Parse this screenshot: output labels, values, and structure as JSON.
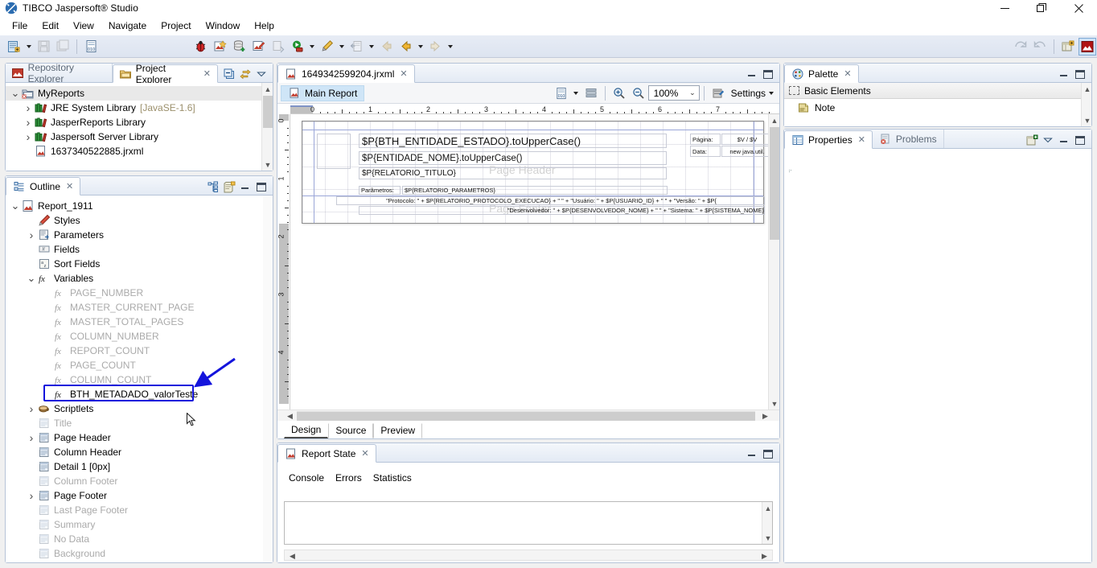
{
  "window": {
    "title": "TIBCO Jaspersoft® Studio",
    "app_icon": "jaspersoft-logo-icon",
    "minimize": "—",
    "maximize": "❐",
    "close": "✕"
  },
  "menubar": {
    "items": [
      "File",
      "Edit",
      "View",
      "Navigate",
      "Project",
      "Window",
      "Help"
    ]
  },
  "toolbar": {
    "groups": [
      {
        "icons": [
          "new-report-icon",
          "dropdown-arrow",
          "save-icon",
          "save-all-icon"
        ]
      },
      {
        "icons": [
          "compile-report-icon"
        ]
      },
      {
        "icons": [
          "debug-icon",
          "new-jrxml-icon",
          "new-datasource-icon",
          "new-adapter-icon",
          "export-icon",
          "run-icon",
          "dropdown-arrow",
          "format-brush-icon",
          "dropdown-arrow",
          "import-icon",
          "dropdown-arrow",
          "back-disabled-icon",
          "back-icon",
          "dropdown-arrow",
          "forward-icon",
          "dropdown-arrow"
        ]
      },
      {
        "icons": [
          "undo-icon",
          "redo-icon"
        ]
      }
    ],
    "perspectives": [
      "open-perspective-icon",
      "jaspersoft-perspective-icon"
    ]
  },
  "project_explorer": {
    "tabs": [
      {
        "label": "Repository Explorer",
        "icon": "repository-icon",
        "active": false,
        "closable": false
      },
      {
        "label": "Project Explorer",
        "icon": "project-folder-icon",
        "active": true,
        "closable": true
      }
    ],
    "actions": [
      "collapse-all-icon",
      "link-with-editor-icon",
      "view-menu-icon"
    ],
    "tree": [
      {
        "label": "MyReports",
        "icon": "project-icon",
        "indent": 0,
        "twist": "open",
        "muted": false,
        "selected": true,
        "sublabel": ""
      },
      {
        "label": "JRE System Library",
        "icon": "library-icon",
        "indent": 1,
        "twist": "closed",
        "muted": false,
        "selected": false,
        "sublabel": "[JavaSE-1.6]"
      },
      {
        "label": "JasperReports Library",
        "icon": "library-icon",
        "indent": 1,
        "twist": "closed",
        "muted": false,
        "selected": false,
        "sublabel": ""
      },
      {
        "label": "Jaspersoft Server Library",
        "icon": "library-icon",
        "indent": 1,
        "twist": "closed",
        "muted": false,
        "selected": false,
        "sublabel": ""
      },
      {
        "label": "1637340522885.jrxml",
        "icon": "jrxml-file-icon",
        "indent": 1,
        "twist": "none",
        "muted": false,
        "selected": false,
        "sublabel": ""
      }
    ]
  },
  "outline": {
    "tab": {
      "label": "Outline",
      "icon": "outline-icon",
      "closable": true
    },
    "actions": [
      "show-tree-icon",
      "properties-icon",
      "minimize-icon",
      "maximize-icon"
    ],
    "tree": [
      {
        "label": "Report_1911",
        "icon": "report-icon",
        "indent": 0,
        "twist": "open",
        "muted": false,
        "highlight": false
      },
      {
        "label": "Styles",
        "icon": "styles-icon",
        "indent": 1,
        "twist": "none",
        "muted": false,
        "highlight": false
      },
      {
        "label": "Parameters",
        "icon": "parameters-icon",
        "indent": 1,
        "twist": "closed",
        "muted": false,
        "highlight": false
      },
      {
        "label": "Fields",
        "icon": "fields-icon",
        "indent": 1,
        "twist": "none",
        "muted": false,
        "highlight": false
      },
      {
        "label": "Sort Fields",
        "icon": "sort-fields-icon",
        "indent": 1,
        "twist": "none",
        "muted": false,
        "highlight": false
      },
      {
        "label": "Variables",
        "icon": "variables-fx-icon",
        "indent": 1,
        "twist": "open",
        "muted": false,
        "highlight": false
      },
      {
        "label": "PAGE_NUMBER",
        "icon": "fx-icon",
        "indent": 2,
        "twist": "none",
        "muted": true,
        "highlight": false
      },
      {
        "label": "MASTER_CURRENT_PAGE",
        "icon": "fx-icon",
        "indent": 2,
        "twist": "none",
        "muted": true,
        "highlight": false
      },
      {
        "label": "MASTER_TOTAL_PAGES",
        "icon": "fx-icon",
        "indent": 2,
        "twist": "none",
        "muted": true,
        "highlight": false
      },
      {
        "label": "COLUMN_NUMBER",
        "icon": "fx-icon",
        "indent": 2,
        "twist": "none",
        "muted": true,
        "highlight": false
      },
      {
        "label": "REPORT_COUNT",
        "icon": "fx-icon",
        "indent": 2,
        "twist": "none",
        "muted": true,
        "highlight": false
      },
      {
        "label": "PAGE_COUNT",
        "icon": "fx-icon",
        "indent": 2,
        "twist": "none",
        "muted": true,
        "highlight": false
      },
      {
        "label": "COLUMN_COUNT",
        "icon": "fx-icon",
        "indent": 2,
        "twist": "none",
        "muted": true,
        "highlight": false
      },
      {
        "label": "BTH_METADADO_valorTeste",
        "icon": "fx-icon",
        "indent": 2,
        "twist": "none",
        "muted": false,
        "highlight": true
      },
      {
        "label": "Scriptlets",
        "icon": "scriptlets-icon",
        "indent": 1,
        "twist": "closed",
        "muted": false,
        "highlight": false
      },
      {
        "label": "Title",
        "icon": "band-icon",
        "indent": 1,
        "twist": "none",
        "muted": true,
        "highlight": false
      },
      {
        "label": "Page Header",
        "icon": "band-icon",
        "indent": 1,
        "twist": "closed",
        "muted": false,
        "highlight": false
      },
      {
        "label": "Column Header",
        "icon": "band-icon",
        "indent": 1,
        "twist": "none",
        "muted": false,
        "highlight": false
      },
      {
        "label": "Detail 1 [0px]",
        "icon": "band-icon",
        "indent": 1,
        "twist": "none",
        "muted": false,
        "highlight": false
      },
      {
        "label": "Column Footer",
        "icon": "band-icon",
        "indent": 1,
        "twist": "none",
        "muted": true,
        "highlight": false
      },
      {
        "label": "Page Footer",
        "icon": "band-icon",
        "indent": 1,
        "twist": "closed",
        "muted": false,
        "highlight": false
      },
      {
        "label": "Last Page Footer",
        "icon": "band-icon",
        "indent": 1,
        "twist": "none",
        "muted": true,
        "highlight": false
      },
      {
        "label": "Summary",
        "icon": "band-icon",
        "indent": 1,
        "twist": "none",
        "muted": true,
        "highlight": false
      },
      {
        "label": "No Data",
        "icon": "band-icon",
        "indent": 1,
        "twist": "none",
        "muted": true,
        "highlight": false
      },
      {
        "label": "Background",
        "icon": "band-icon",
        "indent": 1,
        "twist": "none",
        "muted": true,
        "highlight": false
      }
    ]
  },
  "editor": {
    "tab": {
      "label": "1649342599204.jrxml",
      "icon": "jrxml-file-icon",
      "closable": true
    },
    "actions": [
      "minimize-icon",
      "maximize-icon"
    ],
    "toolbar": {
      "main_report_label": "Main Report",
      "main_report_icon": "report-icon",
      "icons": [
        "compile-icon",
        "dropdown-arrow",
        "bands-icon"
      ],
      "zoom_in_icon": "zoom-in-icon",
      "zoom_out_icon": "zoom-out-icon",
      "zoom_value": "100%",
      "settings_icon": "settings-icon",
      "settings_label": "Settings",
      "settings_arrow": "dropdown-arrow"
    },
    "ruler_h": [
      "0",
      "1",
      "2",
      "3",
      "4",
      "5",
      "6",
      "7"
    ],
    "ruler_v": [
      "0",
      "1",
      "2",
      "3",
      "4"
    ],
    "bands": [
      {
        "name": "Page Header",
        "watermark": "Page Header"
      },
      {
        "name": "Page Footer",
        "watermark": "Page Footer"
      }
    ],
    "elements": [
      {
        "id": "entidade-estado",
        "text": "$P{BTH_ENTIDADE_ESTADO}.toUpperCase()",
        "size": "lg"
      },
      {
        "id": "entidade-nome",
        "text": "$P{ENTIDADE_NOME}.toUpperCase()",
        "size": "md"
      },
      {
        "id": "relatorio-titulo",
        "text": "$P{RELATORIO_TITULO}",
        "size": "sm"
      },
      {
        "id": "parametros-label",
        "text": "Parâmetros:",
        "size": "xs"
      },
      {
        "id": "parametros-value",
        "text": "$P{RELATORIO_PARAMETROS}",
        "size": "xs"
      },
      {
        "id": "protocolo-line",
        "text": "\"Protocolo: \" +  $P{RELATORIO_PROTOCOLO_EXECUCAO} + \"    \" + \"Usuário: \" + $P{USUARIO_ID} + \"     \" + \"Versão: \" + $P{",
        "size": "xs"
      },
      {
        "id": "desenvolvedor-line",
        "text": "\"Desenvolvedor: \" +  $P{DESENVOLVEDOR_NOME} + \"    \" + \"Sistema: \" + $P{SISTEMA_NOME}",
        "size": "xs"
      },
      {
        "id": "pagina-label",
        "text": "Página:",
        "size": "xs"
      },
      {
        "id": "pagina-value",
        "text": "$V /    $V",
        "size": "xs"
      },
      {
        "id": "data-label",
        "text": "Data:",
        "size": "xs"
      },
      {
        "id": "data-value",
        "text": "new java.util.",
        "size": "xs"
      }
    ],
    "bottom_tabs": [
      {
        "label": "Design",
        "active": true
      },
      {
        "label": "Source",
        "active": false
      },
      {
        "label": "Preview",
        "active": false
      }
    ]
  },
  "report_state": {
    "tab": {
      "label": "Report State",
      "icon": "report-icon",
      "closable": true
    },
    "actions": [
      "minimize-icon",
      "maximize-icon"
    ],
    "subtabs": [
      "Console",
      "Errors",
      "Statistics"
    ],
    "console_text": ""
  },
  "palette": {
    "tab": {
      "label": "Palette",
      "icon": "palette-icon",
      "closable": true
    },
    "actions": [
      "minimize-icon",
      "maximize-icon"
    ],
    "category": {
      "label": "Basic Elements",
      "icon": "dashed-box-icon",
      "collapse_icon": "collapse-icon"
    },
    "items": [
      {
        "label": "Note",
        "icon": "note-icon"
      }
    ]
  },
  "properties": {
    "tabs": [
      {
        "label": "Properties",
        "icon": "properties-icon",
        "active": true,
        "closable": true
      },
      {
        "label": "Problems",
        "icon": "problems-icon",
        "active": false,
        "closable": false
      }
    ],
    "actions": [
      "pin-icon",
      "view-menu-icon",
      "minimize-icon",
      "maximize-icon"
    ]
  },
  "annotation": {
    "highlight_target": "BTH_METADADO_valorTeste",
    "color": "#1414dc"
  }
}
